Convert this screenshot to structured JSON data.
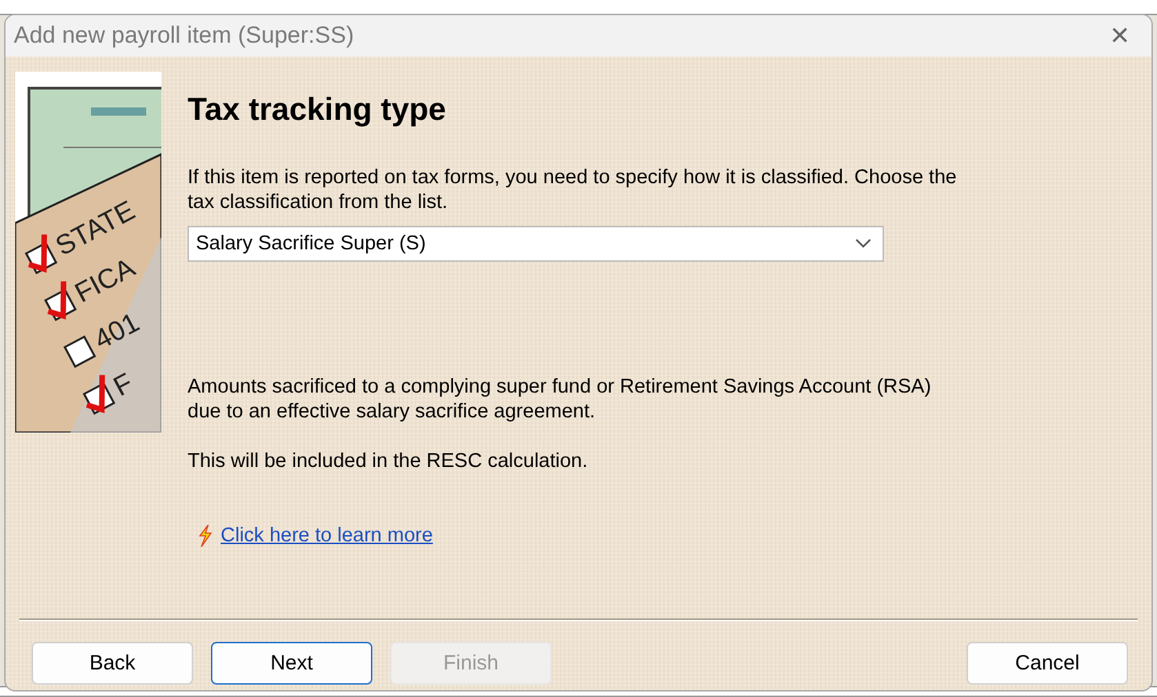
{
  "window": {
    "title": "Add new payroll item (Super:SS)",
    "close_glyph": "✕"
  },
  "illustration": {
    "items": [
      {
        "label": "STATE",
        "checked": true
      },
      {
        "label": "FICA",
        "checked": true
      },
      {
        "label": "401",
        "checked": false
      },
      {
        "label": "F",
        "checked": true
      }
    ]
  },
  "heading": "Tax tracking type",
  "intro": "If this item is reported on tax forms, you need to specify how it is classified. Choose the tax classification from the list.",
  "classification": {
    "value": "Salary Sacrifice Super (S)"
  },
  "description": [
    "Amounts sacrificed to a complying super fund or Retirement Savings Account (RSA) due to an effective salary sacrifice agreement.",
    "This will be included in the RESC calculation."
  ],
  "learn_more_link": "Click here to learn more",
  "buttons": [
    {
      "label": "Back",
      "kind": "normal",
      "disabled": false,
      "focused": false
    },
    {
      "label": "Next",
      "kind": "normal",
      "disabled": false,
      "focused": true
    },
    {
      "label": "Finish",
      "kind": "normal",
      "disabled": true,
      "focused": false
    },
    {
      "label": "Cancel",
      "kind": "cancel",
      "disabled": false,
      "focused": false
    }
  ]
}
